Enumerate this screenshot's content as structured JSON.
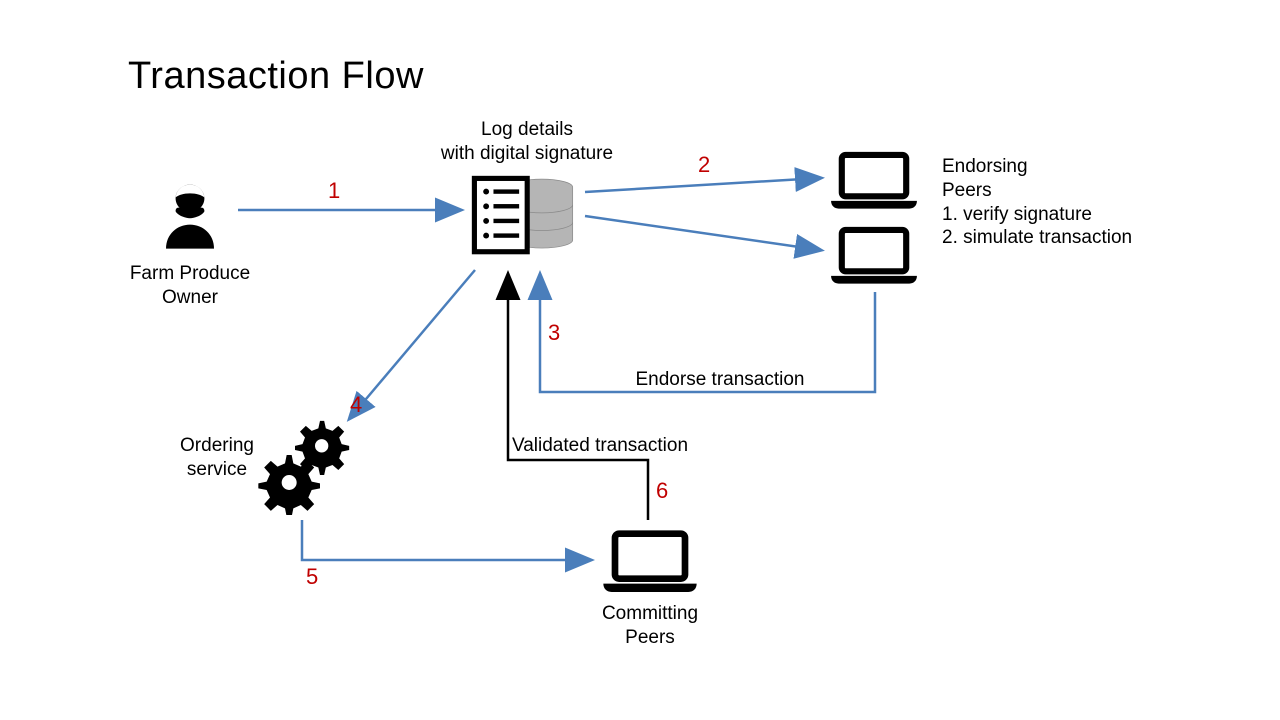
{
  "title": "Transaction Flow",
  "nodes": {
    "farm_owner": {
      "line1": "Farm Produce",
      "line2": "Owner"
    },
    "log": {
      "line1": "Log details",
      "line2": "with digital signature"
    },
    "endorsing": {
      "line1": "Endorsing",
      "line2": "Peers",
      "bullet1": "1. verify signature",
      "bullet2": "2. simulate transaction"
    },
    "ordering": {
      "line1": "Ordering",
      "line2": "service"
    },
    "committing": {
      "line1": "Committing",
      "line2": "Peers"
    }
  },
  "edges": {
    "endorse": "Endorse transaction",
    "validated": "Validated transaction"
  },
  "steps": {
    "s1": "1",
    "s2": "2",
    "s3": "3",
    "s4": "4",
    "s5": "5",
    "s6": "6"
  },
  "chart_data": {
    "type": "flow-diagram",
    "title": "Transaction Flow",
    "nodes": [
      {
        "id": "farm_owner",
        "label": "Farm Produce Owner",
        "icon": "user"
      },
      {
        "id": "log",
        "label": "Log details with digital signature",
        "icon": "ledger-database"
      },
      {
        "id": "endorsing_peers",
        "label": "Endorsing Peers",
        "icon": "laptops",
        "details": [
          "1. verify signature",
          "2. simulate transaction"
        ]
      },
      {
        "id": "ordering_service",
        "label": "Ordering service",
        "icon": "gears"
      },
      {
        "id": "committing_peers",
        "label": "Committing Peers",
        "icon": "laptop"
      }
    ],
    "edges": [
      {
        "step": 1,
        "from": "farm_owner",
        "to": "log"
      },
      {
        "step": 2,
        "from": "log",
        "to": "endorsing_peers"
      },
      {
        "step": 3,
        "from": "endorsing_peers",
        "to": "log",
        "label": "Endorse transaction"
      },
      {
        "step": 4,
        "from": "log",
        "to": "ordering_service"
      },
      {
        "step": 5,
        "from": "ordering_service",
        "to": "committing_peers"
      },
      {
        "step": 6,
        "from": "committing_peers",
        "to": "log",
        "label": "Validated transaction"
      }
    ]
  }
}
